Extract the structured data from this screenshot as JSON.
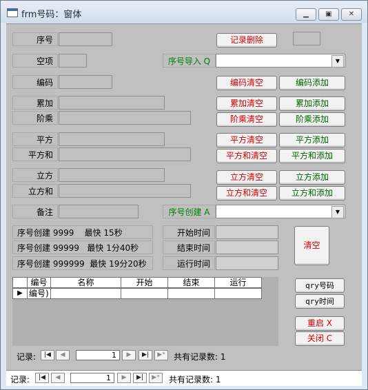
{
  "window": {
    "title": "frm号码：窗体"
  },
  "form": {
    "labels": {
      "xuhao": "序号",
      "kongxiang": "空项",
      "bianma": "编码",
      "leijia": "累加",
      "jiecheng": "阶乘",
      "pingfang": "平方",
      "pingfanghe": "平方和",
      "lifang": "立方",
      "lifanghe": "立方和",
      "beizhu": "备注",
      "import": "序号导入 Q",
      "create": "序号创建 A",
      "start": "开始时间",
      "end": "结束时间",
      "run": "运行时间"
    },
    "create_stats": [
      {
        "text": "序号创建 9999    最快 15秒"
      },
      {
        "text": "序号创建 99999   最快 1分40秒"
      },
      {
        "text": "序号创建 999999  最快 19分20秒"
      }
    ],
    "buttons": {
      "record_delete": "记录删除",
      "code_clear": "编码清空",
      "code_add": "编码添加",
      "acc_clear": "累加清空",
      "acc_add": "累加添加",
      "fac_clear": "阶乘清空",
      "fac_add": "阶乘添加",
      "sq_clear": "平方清空",
      "sq_add": "平方添加",
      "sqsum_clear": "平方和清空",
      "sqsum_add": "平方和添加",
      "cube_clear": "立方清空",
      "cube_add": "立方添加",
      "cubesum_clear": "立方和清空",
      "cubesum_add": "立方和添加",
      "clear": "清空",
      "qry_code": "qry号码",
      "qry_time": "qry时间",
      "restart": "重启 X",
      "close": "关闭 C"
    },
    "subform": {
      "columns": [
        "编号",
        "名称",
        "开始",
        "结束",
        "运行"
      ],
      "row": {
        "marker": "▶",
        "first": "编号)"
      },
      "nav": {
        "label": "记录:",
        "current": "1",
        "total": "共有记录数: 1"
      }
    }
  },
  "window_nav": {
    "label": "记录:",
    "current": "1",
    "total": "共有记录数: 1"
  }
}
